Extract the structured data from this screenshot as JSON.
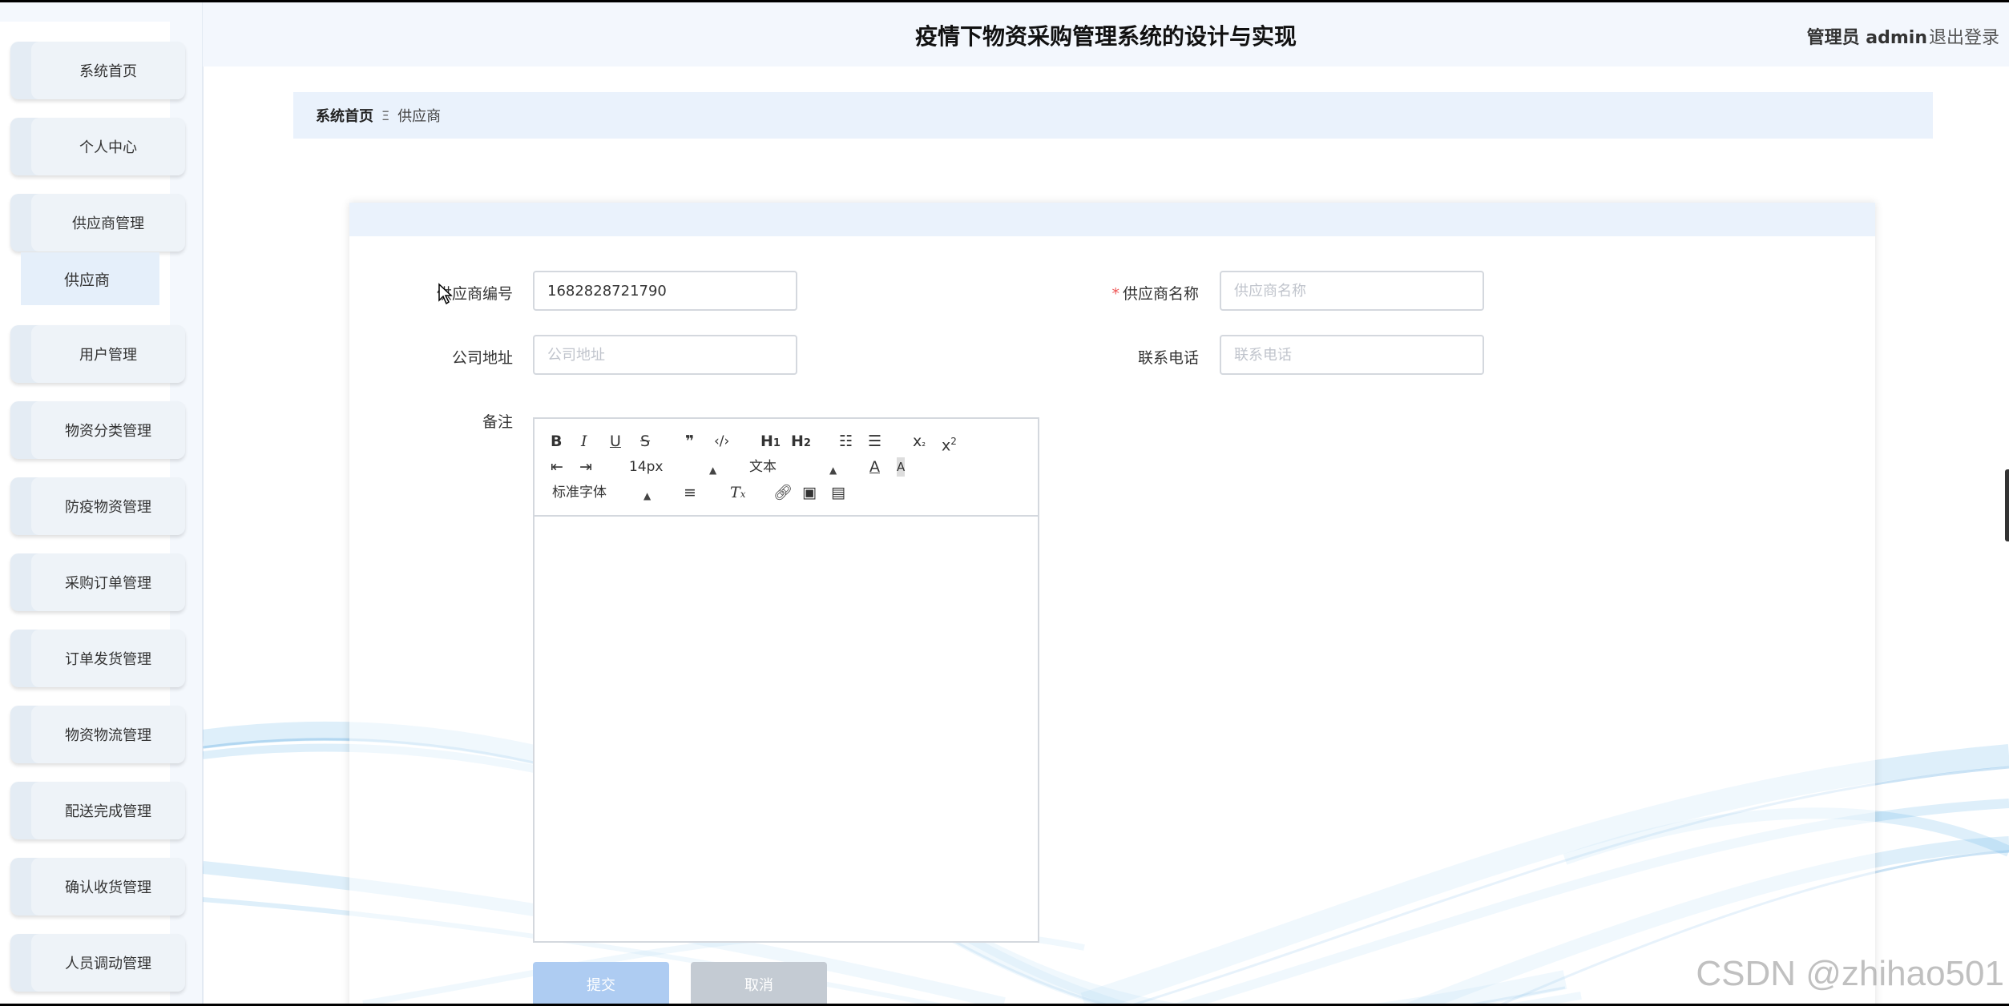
{
  "header": {
    "title": "疫情下物资采购管理系统的设计与实现",
    "user": "管理员 admin",
    "logout": "退出登录"
  },
  "sidebar": {
    "items": [
      {
        "label": "系统首页"
      },
      {
        "label": "个人中心"
      },
      {
        "label": "供应商管理"
      },
      {
        "label": "用户管理"
      },
      {
        "label": "物资分类管理"
      },
      {
        "label": "防疫物资管理"
      },
      {
        "label": "采购订单管理"
      },
      {
        "label": "订单发货管理"
      },
      {
        "label": "物资物流管理"
      },
      {
        "label": "配送完成管理"
      },
      {
        "label": "确认收货管理"
      },
      {
        "label": "人员调动管理"
      }
    ],
    "sub_item": "供应商"
  },
  "breadcrumb": {
    "home": "系统首页",
    "separator": "Ξ",
    "current": "供应商"
  },
  "form": {
    "supplier_no": {
      "label": "供应商编号",
      "value": "1682828721790"
    },
    "supplier_name": {
      "required": "*",
      "label": "供应商名称",
      "placeholder": "供应商名称"
    },
    "address": {
      "label": "公司地址",
      "placeholder": "公司地址"
    },
    "phone": {
      "label": "联系电话",
      "placeholder": "联系电话"
    },
    "remark": {
      "label": "备注"
    }
  },
  "editor": {
    "font_size": "14px",
    "text_type": "文本",
    "font_family": "标准字体"
  },
  "buttons": {
    "submit": "提交",
    "cancel": "取消"
  },
  "watermark": "CSDN @zhihao501"
}
